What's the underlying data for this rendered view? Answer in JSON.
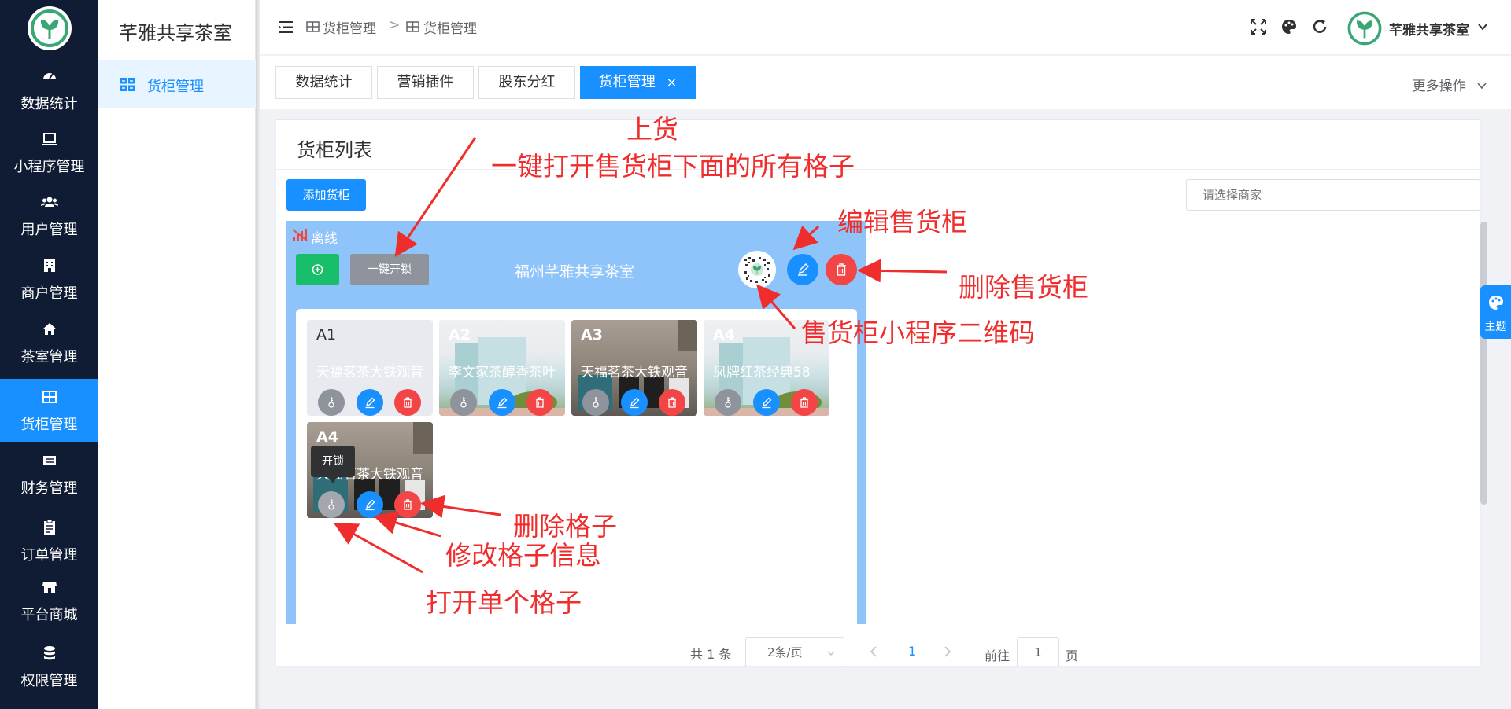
{
  "brand": {
    "app_title": "芊雅共享茶室",
    "user_name": "芊雅共享茶室"
  },
  "nav": {
    "items": [
      {
        "label": "数据统计",
        "icon": "dashboard-icon"
      },
      {
        "label": "小程序管理",
        "icon": "monitor-icon"
      },
      {
        "label": "用户管理",
        "icon": "users-icon"
      },
      {
        "label": "商户管理",
        "icon": "building-icon"
      },
      {
        "label": "茶室管理",
        "icon": "home-icon"
      },
      {
        "label": "货柜管理",
        "icon": "grid-icon"
      },
      {
        "label": "财务管理",
        "icon": "finance-icon"
      },
      {
        "label": "订单管理",
        "icon": "clipboard-icon"
      },
      {
        "label": "平台商城",
        "icon": "shop-icon"
      },
      {
        "label": "权限管理",
        "icon": "database-icon"
      }
    ],
    "active": "货柜管理"
  },
  "subnav": {
    "item": "货柜管理"
  },
  "breadcrumb": {
    "first": "货柜管理",
    "separator": ">",
    "second": "货柜管理"
  },
  "tabs": [
    {
      "label": "数据统计"
    },
    {
      "label": "营销插件"
    },
    {
      "label": "股东分红"
    },
    {
      "label": "货柜管理",
      "close": "×"
    }
  ],
  "more_ops": "更多操作",
  "card": {
    "title": "货柜列表",
    "add_button": "添加货柜",
    "merchant_placeholder": "请选择商家"
  },
  "cabinet": {
    "status": "离线",
    "open_all_button": "一键开锁",
    "name": "福州芊雅共享茶室"
  },
  "slots": [
    {
      "code": "A1",
      "name": "天福茗茶大铁观音"
    },
    {
      "code": "A2",
      "name": "李文家茶醇香茶叶"
    },
    {
      "code": "A3",
      "name": "天福茗茶大铁观音"
    },
    {
      "code": "A4",
      "name": "凤牌红茶经典58"
    },
    {
      "code": "A4",
      "name": "天福茗茶大铁观音"
    }
  ],
  "tooltip": "开锁",
  "pagination": {
    "total": "共 1 条",
    "page_size": "2条/页",
    "current": "1",
    "goto_label": "前往",
    "goto_value": "1",
    "page_suffix": "页"
  },
  "theme_tab": "主题",
  "annotations": {
    "stock": "上货",
    "open_all": "一键打开售货柜下面的所有格子",
    "edit_cabinet": "编辑售货柜",
    "delete_cabinet": "删除售货柜",
    "qr_code": "售货柜小程序二维码",
    "delete_slot": "删除格子",
    "edit_slot": "修改格子信息",
    "open_slot": "打开单个格子"
  },
  "colors": {
    "sidebar_bg": "#0f1c33",
    "primary": "#1890ff",
    "cabinet_bg": "#8ec4f9",
    "success": "#19be6b",
    "danger": "#f34545",
    "annotation": "#f02d2d"
  }
}
